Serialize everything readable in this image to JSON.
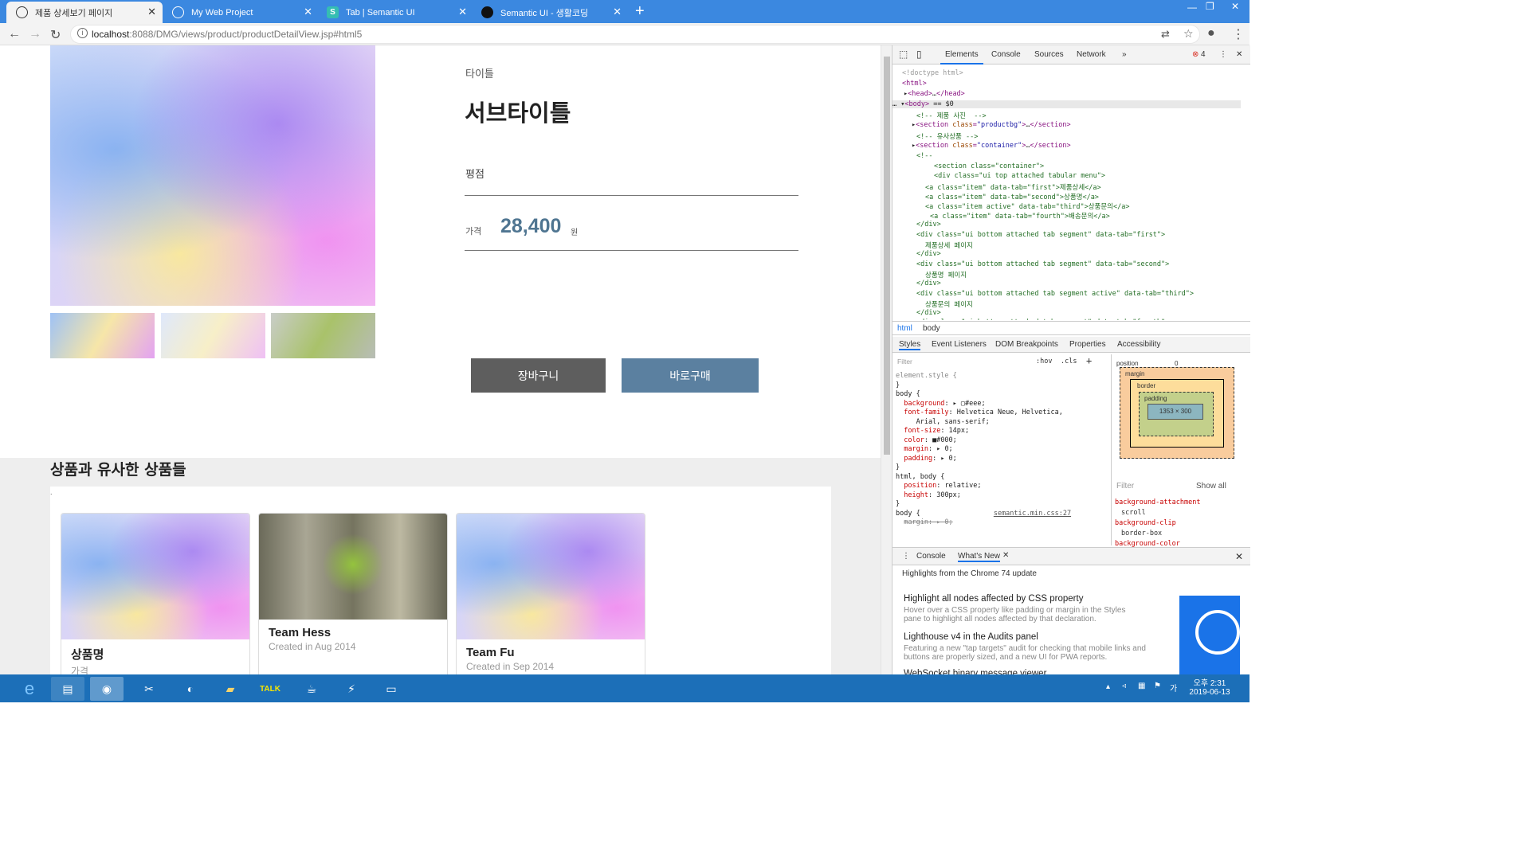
{
  "browser": {
    "tabs": [
      {
        "title": "제품 상세보기 페이지",
        "active": true,
        "icon": "globe-icon"
      },
      {
        "title": "My Web Project",
        "active": false,
        "icon": "globe-icon"
      },
      {
        "title": "Tab | Semantic UI",
        "active": false,
        "icon": "semantic-ui-icon"
      },
      {
        "title": "Semantic UI - 생활코딩",
        "active": false,
        "icon": "opentutorials-icon"
      }
    ],
    "url_host": "localhost",
    "url_path": ":8088/DMG/views/product/productDetailView.jsp#html5"
  },
  "product": {
    "title": "타이틀",
    "subtitle": "서브타이틀",
    "rating_label": "평점",
    "price_label": "가격",
    "price": "28,400",
    "currency": "원",
    "cart_button": "장바구니",
    "buy_button": "바로구매"
  },
  "similar": {
    "heading": "상품과 유사한 상품들",
    "cards": [
      {
        "name": "상품명",
        "meta": "가격"
      },
      {
        "name": "Team Hess",
        "meta": "Created in Aug 2014"
      },
      {
        "name": "Team Fu",
        "meta": "Created in Sep 2014"
      }
    ]
  },
  "devtools": {
    "tabs": [
      "Elements",
      "Console",
      "Sources",
      "Network"
    ],
    "error_count": "4",
    "crumbs": [
      "html",
      "body"
    ],
    "subtabs": [
      "Styles",
      "Event Listeners",
      "DOM Breakpoints",
      "Properties",
      "Accessibility"
    ],
    "filter_placeholder": "Filter",
    "hov": ":hov",
    "cls": ".cls",
    "box": {
      "position": "position",
      "position_val": "0",
      "margin": "margin",
      "border": "border",
      "padding": "padding",
      "content": "1353 × 300",
      "dash": "–"
    },
    "show_all": "Show all",
    "computed": [
      "background-attachment",
      "scroll",
      "background-clip",
      "border-box",
      "background-color"
    ],
    "drawer_tabs": [
      "Console",
      "What's New"
    ],
    "drawer_highlight": "Highlights from the Chrome 74 update",
    "news": [
      {
        "title": "Highlight all nodes affected by CSS property",
        "text": "Hover over a CSS property like padding or margin in the Styles pane to highlight all nodes affected by that declaration."
      },
      {
        "title": "Lighthouse v4 in the Audits panel",
        "text": "Featuring a new \"tap targets\" audit for checking that mobile links and buttons are properly sized, and a new UI for PWA reports."
      },
      {
        "title": "WebSocket binary message viewer",
        "text": ""
      }
    ]
  },
  "taskbar": {
    "time": "오후 2:31",
    "date": "2019-06-13",
    "apps": [
      "ie-icon",
      "file-explorer-icon",
      "chrome-icon",
      "snipping-icon",
      "eclipse-icon",
      "folder-icon",
      "kakaotalk-icon",
      "java-ee-icon",
      "filezilla-icon",
      "notepad-icon"
    ]
  }
}
